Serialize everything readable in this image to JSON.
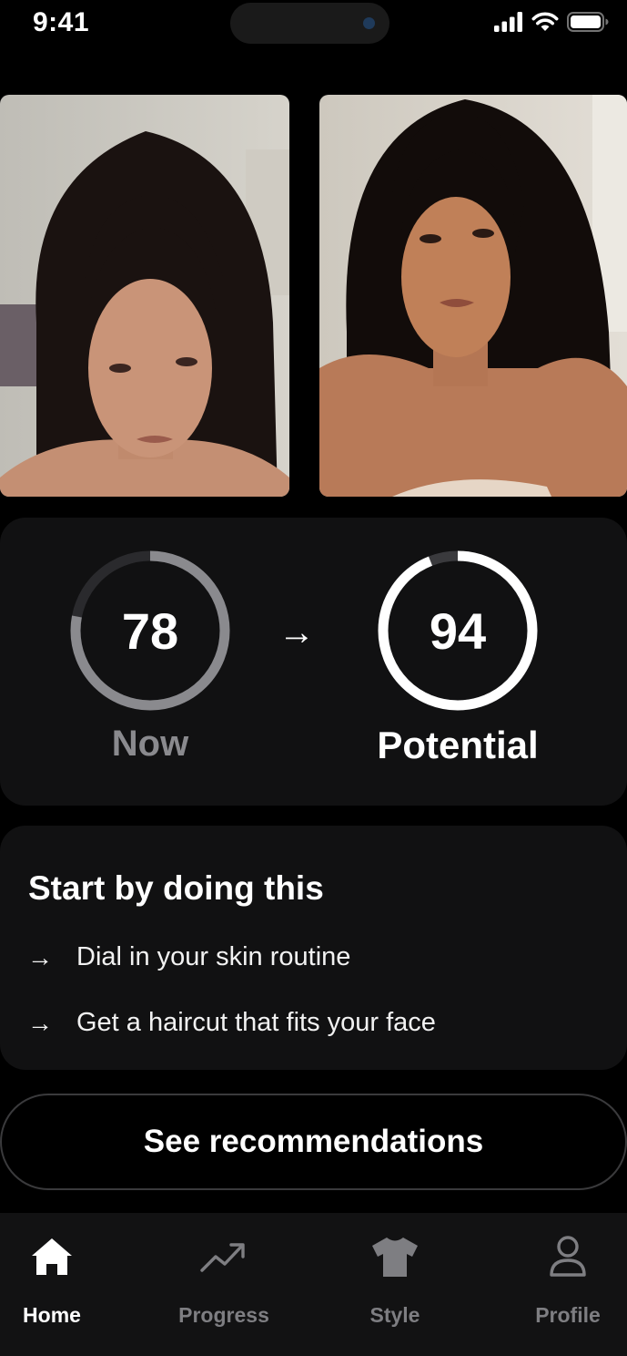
{
  "status_bar": {
    "time": "9:41",
    "icons": [
      "signal-icon",
      "wifi-icon",
      "battery-icon"
    ]
  },
  "photos": {
    "now": {
      "alt": "Current photo",
      "icon": "portrait-photo"
    },
    "potential": {
      "alt": "Potential photo",
      "icon": "portrait-photo"
    }
  },
  "scores": {
    "now": {
      "value": "78",
      "label": "Now",
      "progress": 0.78,
      "color": "#8a8a8e"
    },
    "arrow": "→",
    "potential": {
      "value": "94",
      "label": "Potential",
      "progress": 0.94,
      "color": "#ffffff"
    }
  },
  "actions": {
    "title": "Start by doing this",
    "items": [
      {
        "arrow": "→",
        "text": "Dial in your skin routine"
      },
      {
        "arrow": "→",
        "text": "Get a haircut that fits your face"
      }
    ]
  },
  "cta": {
    "label": "See recommendations"
  },
  "tabs": [
    {
      "label": "Home",
      "icon": "home-icon",
      "active": true
    },
    {
      "label": "Progress",
      "icon": "trend-icon",
      "active": false
    },
    {
      "label": "Style",
      "icon": "shirt-icon",
      "active": false
    },
    {
      "label": "Profile",
      "icon": "person-icon",
      "active": false
    }
  ],
  "colors": {
    "background": "#000000",
    "card": "#111112",
    "muted": "#8a8a8e",
    "accent": "#ffffff"
  }
}
